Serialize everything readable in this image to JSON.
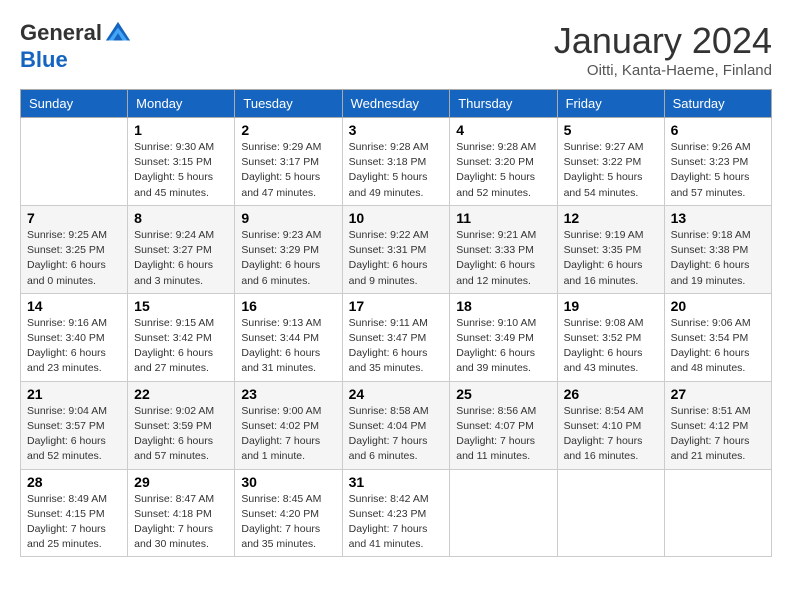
{
  "logo": {
    "general": "General",
    "blue": "Blue"
  },
  "header": {
    "month": "January 2024",
    "location": "Oitti, Kanta-Haeme, Finland"
  },
  "weekdays": [
    "Sunday",
    "Monday",
    "Tuesday",
    "Wednesday",
    "Thursday",
    "Friday",
    "Saturday"
  ],
  "weeks": [
    [
      {
        "day": "",
        "sunrise": "",
        "sunset": "",
        "daylight": ""
      },
      {
        "day": "1",
        "sunrise": "Sunrise: 9:30 AM",
        "sunset": "Sunset: 3:15 PM",
        "daylight": "Daylight: 5 hours and 45 minutes."
      },
      {
        "day": "2",
        "sunrise": "Sunrise: 9:29 AM",
        "sunset": "Sunset: 3:17 PM",
        "daylight": "Daylight: 5 hours and 47 minutes."
      },
      {
        "day": "3",
        "sunrise": "Sunrise: 9:28 AM",
        "sunset": "Sunset: 3:18 PM",
        "daylight": "Daylight: 5 hours and 49 minutes."
      },
      {
        "day": "4",
        "sunrise": "Sunrise: 9:28 AM",
        "sunset": "Sunset: 3:20 PM",
        "daylight": "Daylight: 5 hours and 52 minutes."
      },
      {
        "day": "5",
        "sunrise": "Sunrise: 9:27 AM",
        "sunset": "Sunset: 3:22 PM",
        "daylight": "Daylight: 5 hours and 54 minutes."
      },
      {
        "day": "6",
        "sunrise": "Sunrise: 9:26 AM",
        "sunset": "Sunset: 3:23 PM",
        "daylight": "Daylight: 5 hours and 57 minutes."
      }
    ],
    [
      {
        "day": "7",
        "sunrise": "Sunrise: 9:25 AM",
        "sunset": "Sunset: 3:25 PM",
        "daylight": "Daylight: 6 hours and 0 minutes."
      },
      {
        "day": "8",
        "sunrise": "Sunrise: 9:24 AM",
        "sunset": "Sunset: 3:27 PM",
        "daylight": "Daylight: 6 hours and 3 minutes."
      },
      {
        "day": "9",
        "sunrise": "Sunrise: 9:23 AM",
        "sunset": "Sunset: 3:29 PM",
        "daylight": "Daylight: 6 hours and 6 minutes."
      },
      {
        "day": "10",
        "sunrise": "Sunrise: 9:22 AM",
        "sunset": "Sunset: 3:31 PM",
        "daylight": "Daylight: 6 hours and 9 minutes."
      },
      {
        "day": "11",
        "sunrise": "Sunrise: 9:21 AM",
        "sunset": "Sunset: 3:33 PM",
        "daylight": "Daylight: 6 hours and 12 minutes."
      },
      {
        "day": "12",
        "sunrise": "Sunrise: 9:19 AM",
        "sunset": "Sunset: 3:35 PM",
        "daylight": "Daylight: 6 hours and 16 minutes."
      },
      {
        "day": "13",
        "sunrise": "Sunrise: 9:18 AM",
        "sunset": "Sunset: 3:38 PM",
        "daylight": "Daylight: 6 hours and 19 minutes."
      }
    ],
    [
      {
        "day": "14",
        "sunrise": "Sunrise: 9:16 AM",
        "sunset": "Sunset: 3:40 PM",
        "daylight": "Daylight: 6 hours and 23 minutes."
      },
      {
        "day": "15",
        "sunrise": "Sunrise: 9:15 AM",
        "sunset": "Sunset: 3:42 PM",
        "daylight": "Daylight: 6 hours and 27 minutes."
      },
      {
        "day": "16",
        "sunrise": "Sunrise: 9:13 AM",
        "sunset": "Sunset: 3:44 PM",
        "daylight": "Daylight: 6 hours and 31 minutes."
      },
      {
        "day": "17",
        "sunrise": "Sunrise: 9:11 AM",
        "sunset": "Sunset: 3:47 PM",
        "daylight": "Daylight: 6 hours and 35 minutes."
      },
      {
        "day": "18",
        "sunrise": "Sunrise: 9:10 AM",
        "sunset": "Sunset: 3:49 PM",
        "daylight": "Daylight: 6 hours and 39 minutes."
      },
      {
        "day": "19",
        "sunrise": "Sunrise: 9:08 AM",
        "sunset": "Sunset: 3:52 PM",
        "daylight": "Daylight: 6 hours and 43 minutes."
      },
      {
        "day": "20",
        "sunrise": "Sunrise: 9:06 AM",
        "sunset": "Sunset: 3:54 PM",
        "daylight": "Daylight: 6 hours and 48 minutes."
      }
    ],
    [
      {
        "day": "21",
        "sunrise": "Sunrise: 9:04 AM",
        "sunset": "Sunset: 3:57 PM",
        "daylight": "Daylight: 6 hours and 52 minutes."
      },
      {
        "day": "22",
        "sunrise": "Sunrise: 9:02 AM",
        "sunset": "Sunset: 3:59 PM",
        "daylight": "Daylight: 6 hours and 57 minutes."
      },
      {
        "day": "23",
        "sunrise": "Sunrise: 9:00 AM",
        "sunset": "Sunset: 4:02 PM",
        "daylight": "Daylight: 7 hours and 1 minute."
      },
      {
        "day": "24",
        "sunrise": "Sunrise: 8:58 AM",
        "sunset": "Sunset: 4:04 PM",
        "daylight": "Daylight: 7 hours and 6 minutes."
      },
      {
        "day": "25",
        "sunrise": "Sunrise: 8:56 AM",
        "sunset": "Sunset: 4:07 PM",
        "daylight": "Daylight: 7 hours and 11 minutes."
      },
      {
        "day": "26",
        "sunrise": "Sunrise: 8:54 AM",
        "sunset": "Sunset: 4:10 PM",
        "daylight": "Daylight: 7 hours and 16 minutes."
      },
      {
        "day": "27",
        "sunrise": "Sunrise: 8:51 AM",
        "sunset": "Sunset: 4:12 PM",
        "daylight": "Daylight: 7 hours and 21 minutes."
      }
    ],
    [
      {
        "day": "28",
        "sunrise": "Sunrise: 8:49 AM",
        "sunset": "Sunset: 4:15 PM",
        "daylight": "Daylight: 7 hours and 25 minutes."
      },
      {
        "day": "29",
        "sunrise": "Sunrise: 8:47 AM",
        "sunset": "Sunset: 4:18 PM",
        "daylight": "Daylight: 7 hours and 30 minutes."
      },
      {
        "day": "30",
        "sunrise": "Sunrise: 8:45 AM",
        "sunset": "Sunset: 4:20 PM",
        "daylight": "Daylight: 7 hours and 35 minutes."
      },
      {
        "day": "31",
        "sunrise": "Sunrise: 8:42 AM",
        "sunset": "Sunset: 4:23 PM",
        "daylight": "Daylight: 7 hours and 41 minutes."
      },
      {
        "day": "",
        "sunrise": "",
        "sunset": "",
        "daylight": ""
      },
      {
        "day": "",
        "sunrise": "",
        "sunset": "",
        "daylight": ""
      },
      {
        "day": "",
        "sunrise": "",
        "sunset": "",
        "daylight": ""
      }
    ]
  ]
}
